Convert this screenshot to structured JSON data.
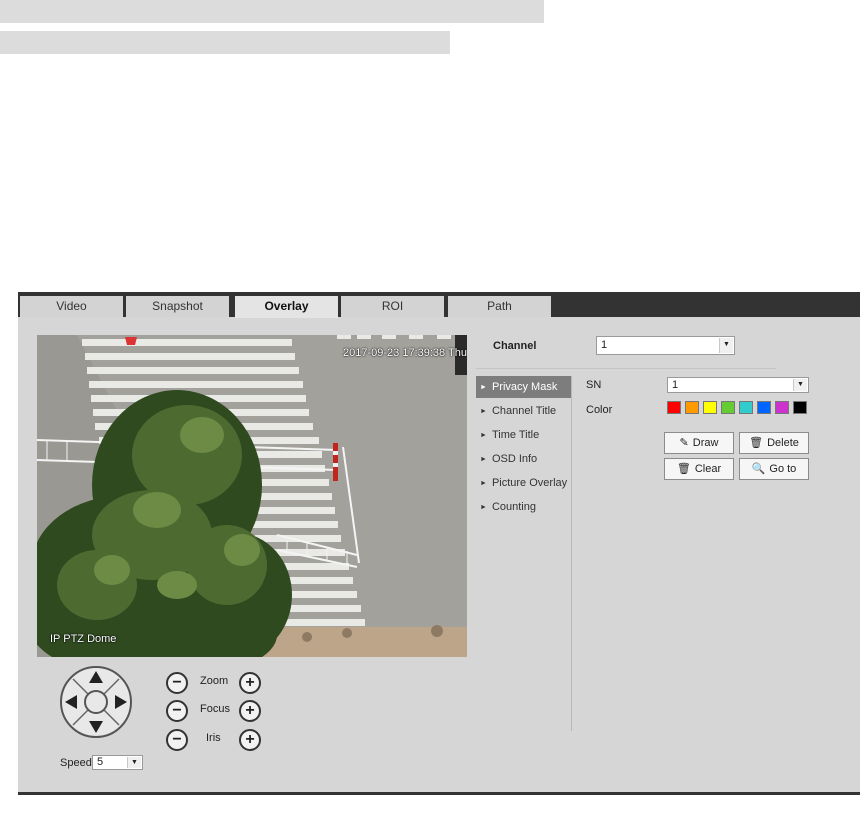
{
  "tabs": [
    {
      "label": "Video"
    },
    {
      "label": "Snapshot"
    },
    {
      "label": "Overlay"
    },
    {
      "label": "ROI"
    },
    {
      "label": "Path"
    }
  ],
  "active_tab": "Overlay",
  "video": {
    "timestamp_osd": "2017-09-23 17:39:38 Thu",
    "channel_osd": "IP PTZ Dome"
  },
  "channel": {
    "label": "Channel",
    "value": "1"
  },
  "menu": {
    "items": [
      {
        "label": "Privacy Mask"
      },
      {
        "label": "Channel Title"
      },
      {
        "label": "Time Title"
      },
      {
        "label": "OSD Info"
      },
      {
        "label": "Picture Overlay"
      },
      {
        "label": "Counting"
      }
    ],
    "active": "Privacy Mask"
  },
  "privacy_mask": {
    "sn_label": "SN",
    "sn_value": "1",
    "color_label": "Color",
    "colors": [
      "#ff0000",
      "#ff9900",
      "#ffff00",
      "#66cc33",
      "#33cccc",
      "#0066ff",
      "#cc33cc",
      "#000000"
    ],
    "buttons": {
      "draw": "Draw",
      "delete": "Delete",
      "clear": "Clear",
      "goto": "Go to"
    }
  },
  "ptz": {
    "zoom_label": "Zoom",
    "focus_label": "Focus",
    "iris_label": "Iris",
    "speed_label": "Speed",
    "speed_value": "5",
    "minus_symbol": "−",
    "plus_symbol": "+"
  }
}
